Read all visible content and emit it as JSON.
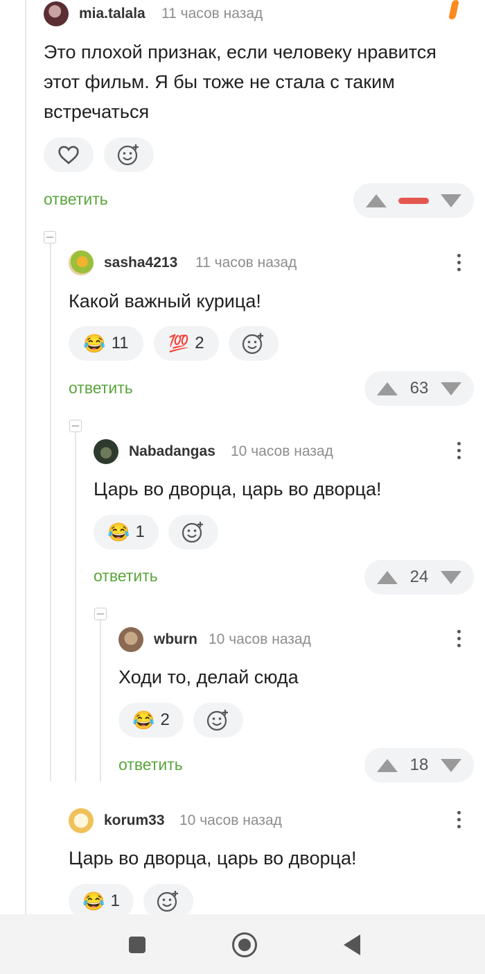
{
  "comments": [
    {
      "author": "mia.talala",
      "time": "11 часов назад",
      "text": "Это плохой признак, если человеку нравится этот фильм. Я бы тоже не стала с таким встречаться",
      "reply_label": "ответить"
    },
    {
      "author": "sasha4213",
      "time": "11 часов назад",
      "text": "Какой важный курица!",
      "reactions": [
        {
          "emoji": "😂",
          "count": "11"
        },
        {
          "emoji": "💯",
          "count": "2"
        }
      ],
      "reply_label": "ответить",
      "score": "63"
    },
    {
      "author": "Nabadangas",
      "time": "10 часов назад",
      "text": "Царь во дворца, царь во дворца!",
      "reactions": [
        {
          "emoji": "😂",
          "count": "1"
        }
      ],
      "reply_label": "ответить",
      "score": "24"
    },
    {
      "author": "wburn",
      "time": "10 часов назад",
      "text": "Ходи то, делай сюда",
      "reactions": [
        {
          "emoji": "😂",
          "count": "2"
        }
      ],
      "reply_label": "ответить",
      "score": "18"
    },
    {
      "author": "korum33",
      "time": "10 часов назад",
      "text": "Царь во дворца, царь во дворца!",
      "reactions": [
        {
          "emoji": "😂",
          "count": "1"
        }
      ]
    }
  ],
  "colors": {
    "reply": "#5aa53c",
    "negative_score": "#e4574f",
    "pill_bg": "#f2f3f5"
  },
  "icons": [
    "heart-icon",
    "add-reaction-icon",
    "upvote-icon",
    "downvote-icon",
    "more-icon",
    "collapse-icon",
    "nav-recents-icon",
    "nav-home-icon",
    "nav-back-icon"
  ]
}
